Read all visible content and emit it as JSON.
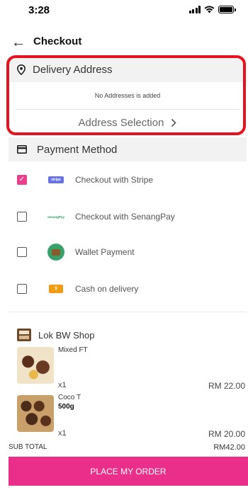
{
  "status_bar": {
    "time": "3:28"
  },
  "header": {
    "back_icon": "arrow-left-icon",
    "title": "Checkout"
  },
  "delivery_address": {
    "icon": "location-pin-icon",
    "title": "Delivery Address",
    "empty_message": "No Addresses is added",
    "selection_label": "Address Selection",
    "selection_icon": "chevron-right-icon"
  },
  "payment_method": {
    "icon": "card-icon",
    "title": "Payment Method",
    "options": [
      {
        "label": "Checkout with Stripe",
        "checked": true,
        "logo": "stripe-logo",
        "logo_text": "stripe"
      },
      {
        "label": "Checkout with SenangPay",
        "checked": false,
        "logo": "senangpay-logo",
        "logo_text": "senangPay"
      },
      {
        "label": "Wallet Payment",
        "checked": false,
        "logo": "wallet-icon"
      },
      {
        "label": "Cash on delivery",
        "checked": false,
        "logo": "cash-icon"
      }
    ]
  },
  "shop": {
    "icon": "shop-icon",
    "name": "Lok BW Shop",
    "items": [
      {
        "name": "Mixed FT",
        "variant": "",
        "qty": "x1",
        "price": "RM 22.00"
      },
      {
        "name": "Coco T",
        "variant": "500g",
        "qty": "x1",
        "price": "RM 20.00"
      }
    ]
  },
  "summary": {
    "subtotal_label": "SUB TOTAL",
    "subtotal_value": "RM42.00"
  },
  "order_button": {
    "label": "PLACE MY ORDER"
  },
  "colors": {
    "accent": "#ea2f8a",
    "highlight": "#e6131f",
    "section_bg": "#f2f2f2"
  }
}
